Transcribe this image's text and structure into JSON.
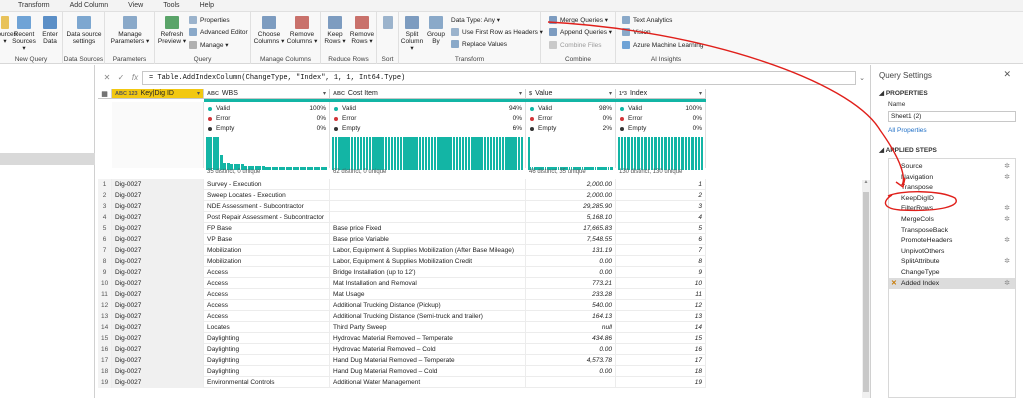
{
  "menu": [
    "Transform",
    "Add Column",
    "View",
    "Tools",
    "Help"
  ],
  "ribbon": {
    "new_query": {
      "label": "New Query",
      "recent": "Recent Sources ▾",
      "enter": "Enter Data",
      "new_src": "Sources ▾"
    },
    "data_sources": {
      "label": "Data Sources",
      "settings": "Data source settings"
    },
    "parameters": {
      "label": "Parameters",
      "manage": "Manage Parameters ▾"
    },
    "query": {
      "label": "Query",
      "refresh": "Refresh Preview ▾",
      "properties": "Properties",
      "advanced": "Advanced Editor",
      "manage": "Manage ▾"
    },
    "manage_columns": {
      "label": "Manage Columns",
      "choose": "Choose Columns ▾",
      "remove": "Remove Columns ▾"
    },
    "reduce_rows": {
      "label": "Reduce Rows",
      "keep": "Keep Rows ▾",
      "remove": "Remove Rows ▾"
    },
    "sort": {
      "label": "Sort"
    },
    "transform": {
      "label": "Transform",
      "split": "Split Column ▾",
      "group": "Group By",
      "datatype": "Data Type: Any ▾",
      "firstrow": "Use First Row as Headers ▾",
      "replace": "Replace Values"
    },
    "combine": {
      "label": "Combine",
      "merge": "Merge Queries ▾",
      "append": "Append Queries ▾",
      "files": "Combine Files"
    },
    "ai": {
      "label": "AI Insights",
      "text": "Text Analytics",
      "vision": "Vision",
      "aml": "Azure Machine Learning"
    }
  },
  "formula": {
    "fx": "fx",
    "text": "= Table.AddIndexColumn(ChangeType, \"Index\", 1, 1, Int64.Type)"
  },
  "columns": [
    {
      "type": "ABC 123",
      "name": "Key|Dig ID",
      "valid": "",
      "error": "",
      "empty": "",
      "dist": ""
    },
    {
      "type": "ABC",
      "name": "WBS",
      "valid": "100%",
      "error": "0%",
      "empty": "0%",
      "dist": "35 distinct, 0 unique"
    },
    {
      "type": "ABC",
      "name": "Cost Item",
      "valid": "94%",
      "error": "0%",
      "empty": "6%",
      "dist": "62 distinct, 0 unique"
    },
    {
      "type": "$",
      "name": "Value",
      "valid": "98%",
      "error": "0%",
      "empty": "2%",
      "dist": "46 distinct, 35 unique"
    },
    {
      "type": "1²3",
      "name": "Index",
      "valid": "100%",
      "error": "0%",
      "empty": "0%",
      "dist": "130 distinct, 130 unique"
    }
  ],
  "profile_labels": {
    "valid": "Valid",
    "error": "Error",
    "empty": "Empty"
  },
  "colors": {
    "valid": "#13b5a5",
    "error": "#d13438",
    "empty": "#333333",
    "selected_header": "#f2c811",
    "annotation": "#e0201b"
  },
  "rows": [
    [
      "1",
      "Dig-0027",
      "Survey - Execution",
      "",
      "2,000.00",
      "1"
    ],
    [
      "2",
      "Dig-0027",
      "Sweep Locates - Execution",
      "",
      "2,000.00",
      "2"
    ],
    [
      "3",
      "Dig-0027",
      "NDE Assessment - Subcontractor",
      "",
      "29,285.90",
      "3"
    ],
    [
      "4",
      "Dig-0027",
      "Post Repair Assessment - Subcontractor",
      "",
      "5,168.10",
      "4"
    ],
    [
      "5",
      "Dig-0027",
      "FP Base",
      "Base price Fixed",
      "17,665.83",
      "5"
    ],
    [
      "6",
      "Dig-0027",
      "VP Base",
      "Base price Variable",
      "7,548.55",
      "6"
    ],
    [
      "7",
      "Dig-0027",
      "Mobilization",
      "Labor, Equipment & Supplies Mobilization (After Base Mileage)",
      "131.19",
      "7"
    ],
    [
      "8",
      "Dig-0027",
      "Mobilization",
      "Labor, Equipment & Supplies Mobilization Credit",
      "0.00",
      "8"
    ],
    [
      "9",
      "Dig-0027",
      "Access",
      "Bridge Installation (up to 12')",
      "0.00",
      "9"
    ],
    [
      "10",
      "Dig-0027",
      "Access",
      "Mat Installation and Removal",
      "773.21",
      "10"
    ],
    [
      "11",
      "Dig-0027",
      "Access",
      "Mat Usage",
      "233.28",
      "11"
    ],
    [
      "12",
      "Dig-0027",
      "Access",
      "Additional Trucking Distance (Pickup)",
      "540.00",
      "12"
    ],
    [
      "13",
      "Dig-0027",
      "Access",
      "Additional Trucking Distance (Semi-truck and trailer)",
      "164.13",
      "13"
    ],
    [
      "14",
      "Dig-0027",
      "Locates",
      "Third Party Sweep",
      "null",
      "14"
    ],
    [
      "15",
      "Dig-0027",
      "Daylighting",
      "Hydrovac Material Removed – Temperate",
      "434.86",
      "15"
    ],
    [
      "16",
      "Dig-0027",
      "Daylighting",
      "Hydrovac Material Removed – Cold",
      "0.00",
      "16"
    ],
    [
      "17",
      "Dig-0027",
      "Daylighting",
      "Hand Dug Material Removed – Temperate",
      "4,573.78",
      "17"
    ],
    [
      "18",
      "Dig-0027",
      "Daylighting",
      "Hand Dug Material Removed – Cold",
      "0.00",
      "18"
    ],
    [
      "19",
      "Dig-0027",
      "Environmental Controls",
      "Additional Water Management",
      "",
      "19"
    ]
  ],
  "settings": {
    "title": "Query Settings",
    "properties": "PROPERTIES",
    "name_label": "Name",
    "name_value": "Sheet1 (2)",
    "all_properties": "All Properties",
    "applied_steps": "APPLIED STEPS",
    "steps": [
      {
        "name": "Source",
        "gear": true
      },
      {
        "name": "Navigation",
        "gear": true
      },
      {
        "name": "Transpose",
        "gear": false
      },
      {
        "name": "KeepDigID",
        "gear": false
      },
      {
        "name": "FilterRows",
        "gear": true
      },
      {
        "name": "MergeCols",
        "gear": true
      },
      {
        "name": "TransposeBack",
        "gear": false
      },
      {
        "name": "PromoteHeaders",
        "gear": true
      },
      {
        "name": "UnpivotOthers",
        "gear": false
      },
      {
        "name": "SplitAttribute",
        "gear": true
      },
      {
        "name": "ChangeType",
        "gear": false
      },
      {
        "name": "Added Index",
        "gear": true,
        "active": true
      }
    ]
  }
}
